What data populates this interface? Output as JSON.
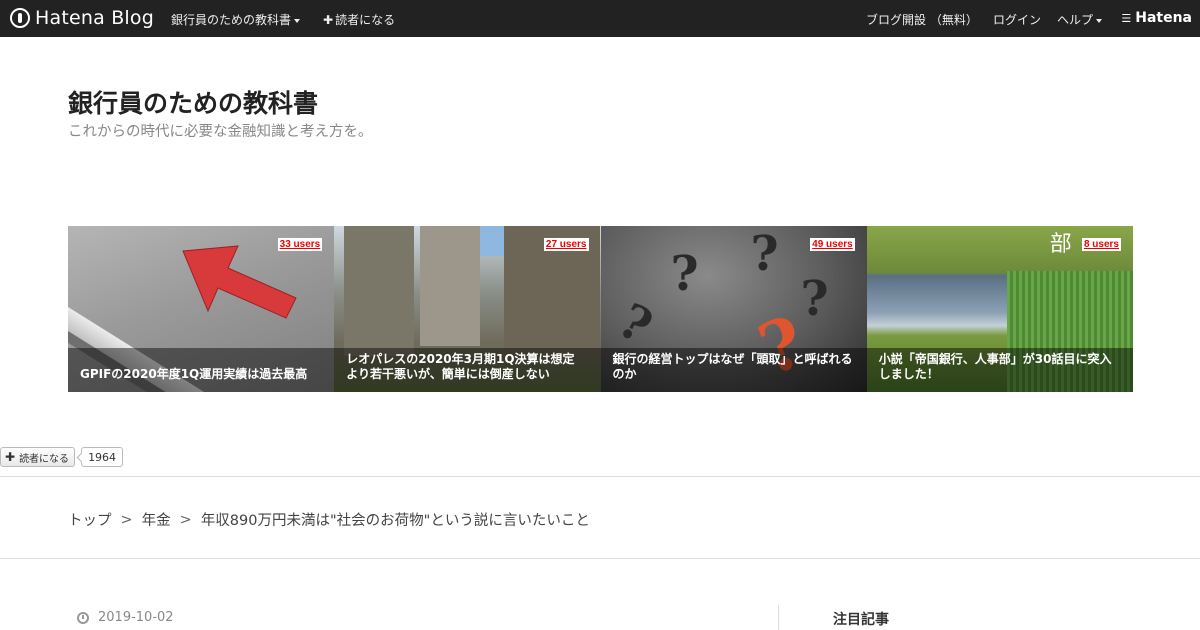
{
  "topbar": {
    "logo_text": "Hatena Blog",
    "blog_menu_label": "銀行員のための教科書",
    "subscribe_label": "読者になる",
    "open_blog_label": "ブログ開設 （無料）",
    "login_label": "ログイン",
    "help_label": "ヘルプ",
    "brand_label": "Hatena"
  },
  "blog": {
    "title": "銀行員のための教科書",
    "description": "これからの時代に必要な金融知識と考え方を。"
  },
  "featured": [
    {
      "title": "GPIFの2020年度1Q運用実績は過去最高",
      "users": "33 users"
    },
    {
      "title": "レオパレスの2020年3月期1Q決算は想定より若干悪いが、簡単には倒産しない",
      "users": "27 users"
    },
    {
      "title": "銀行の経営トップはなぜ「頭取」と呼ばれるのか",
      "users": "49 users"
    },
    {
      "title": "小説「帝国銀行、人事部」が30話目に突入しました！",
      "users": "8 users",
      "image_text": "部"
    }
  ],
  "subscribe_widget": {
    "button_label": "読者になる",
    "count": "1964"
  },
  "breadcrumb": {
    "home": "トップ",
    "separator": ">",
    "category": "年金",
    "current": "年収890万円未満は\"社会のお荷物\"という説に言いたいこと"
  },
  "entry": {
    "date": "2019-10-02"
  },
  "sidebar": {
    "heading": "注目記事"
  },
  "colors": {
    "topbar_bg": "#222222",
    "users_badge": "#e00000",
    "caption_overlay": "rgba(0,0,0,0.45)"
  },
  "icons": [
    "hatena-blog-logo-icon",
    "caret-down-icon",
    "plus-icon",
    "hatena-brand-icon",
    "clock-icon"
  ]
}
